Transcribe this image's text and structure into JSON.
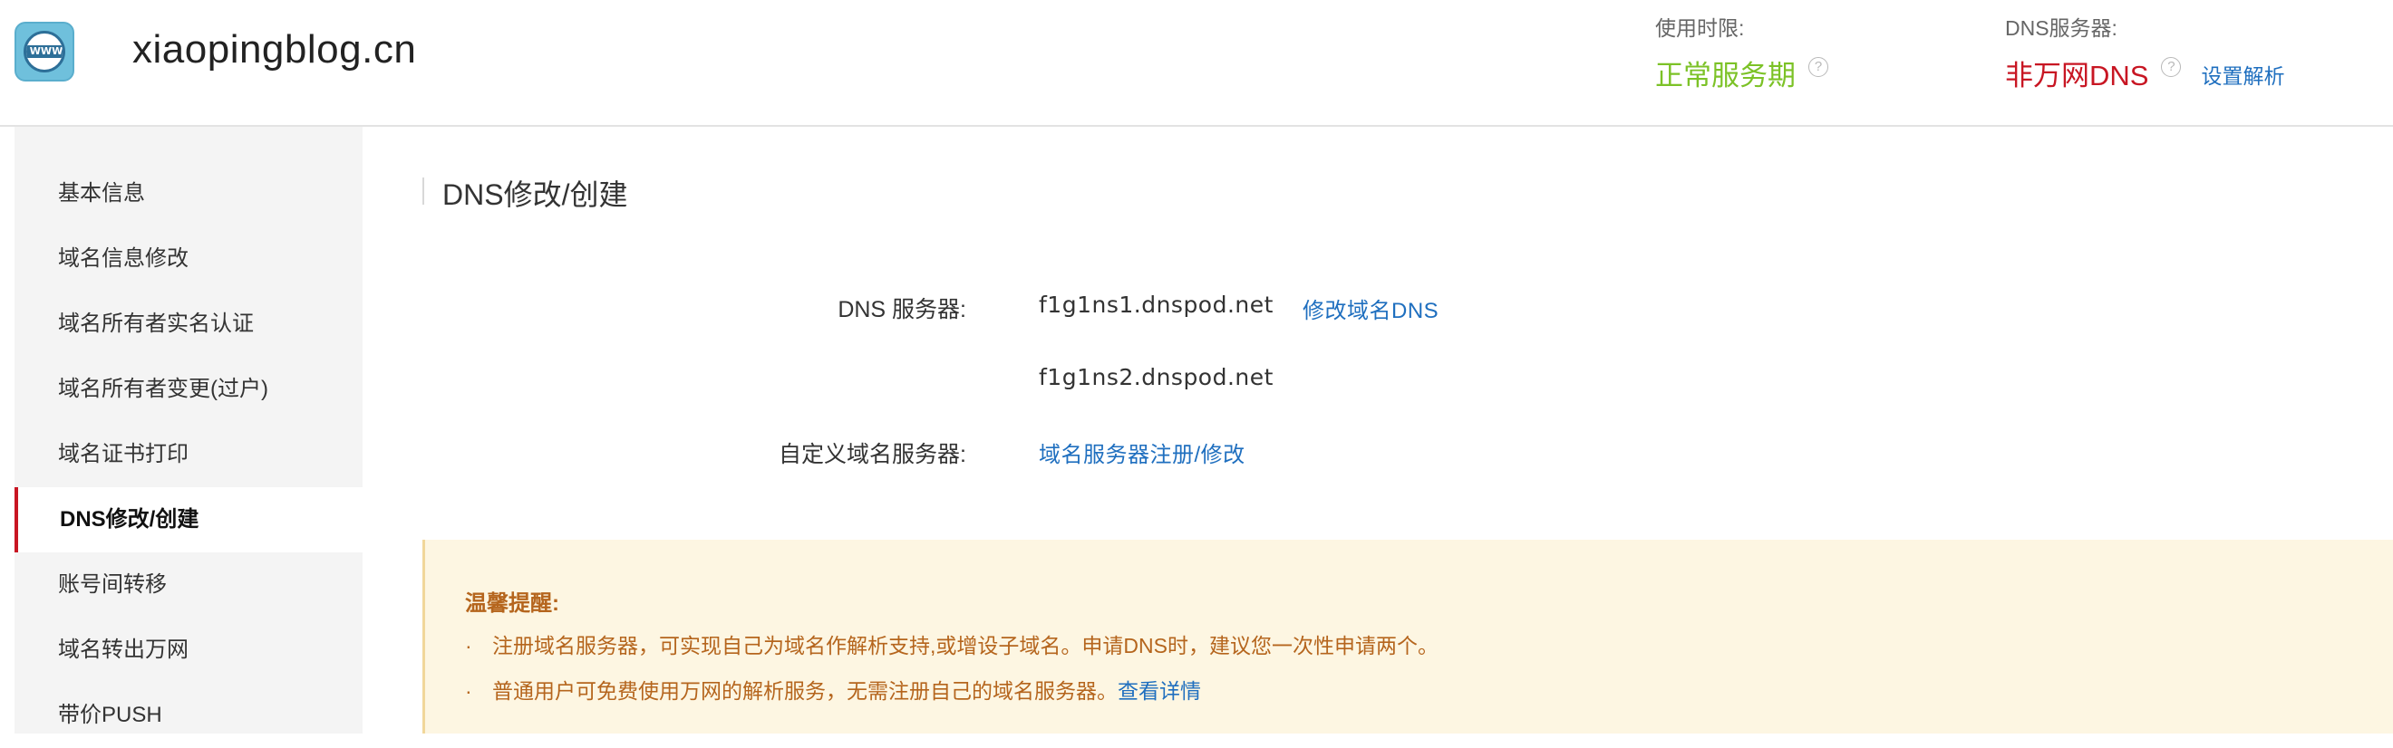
{
  "header": {
    "logo_text": "WWW",
    "domain": "xiaopingblog.cn",
    "usage_label": "使用时限:",
    "usage_value": "正常服务期",
    "usage_color": "#7cc227",
    "dns_label": "DNS服务器:",
    "dns_value": "非万网DNS",
    "dns_color": "#c81623",
    "help_glyph": "?",
    "set_link": "设置解析"
  },
  "sidebar": {
    "items": [
      {
        "label": "基本信息"
      },
      {
        "label": "域名信息修改"
      },
      {
        "label": "域名所有者实名认证"
      },
      {
        "label": "域名所有者变更(过户)"
      },
      {
        "label": "域名证书打印"
      },
      {
        "label": "DNS修改/创建",
        "active": true
      },
      {
        "label": "账号间转移"
      },
      {
        "label": "域名转出万网"
      },
      {
        "label": "带价PUSH"
      }
    ]
  },
  "main": {
    "title": "DNS修改/创建",
    "dns_label": "DNS 服务器:",
    "dns1": "f1g1ns1.dnspod.net",
    "dns2": "f1g1ns2.dnspod.net",
    "modify_link": "修改域名DNS",
    "custom_label": "自定义域名服务器:",
    "custom_link": "域名服务器注册/修改"
  },
  "notice": {
    "title": "温馨提醒:",
    "bullet": "·",
    "item1": "注册域名服务器，可实现自己为域名作解析支持,或增设子域名。申请DNS时，建议您一次性申请两个。",
    "item2": "普通用户可免费使用万网的解析服务，无需注册自己的域名服务器。",
    "item2_link": "查看详情"
  }
}
